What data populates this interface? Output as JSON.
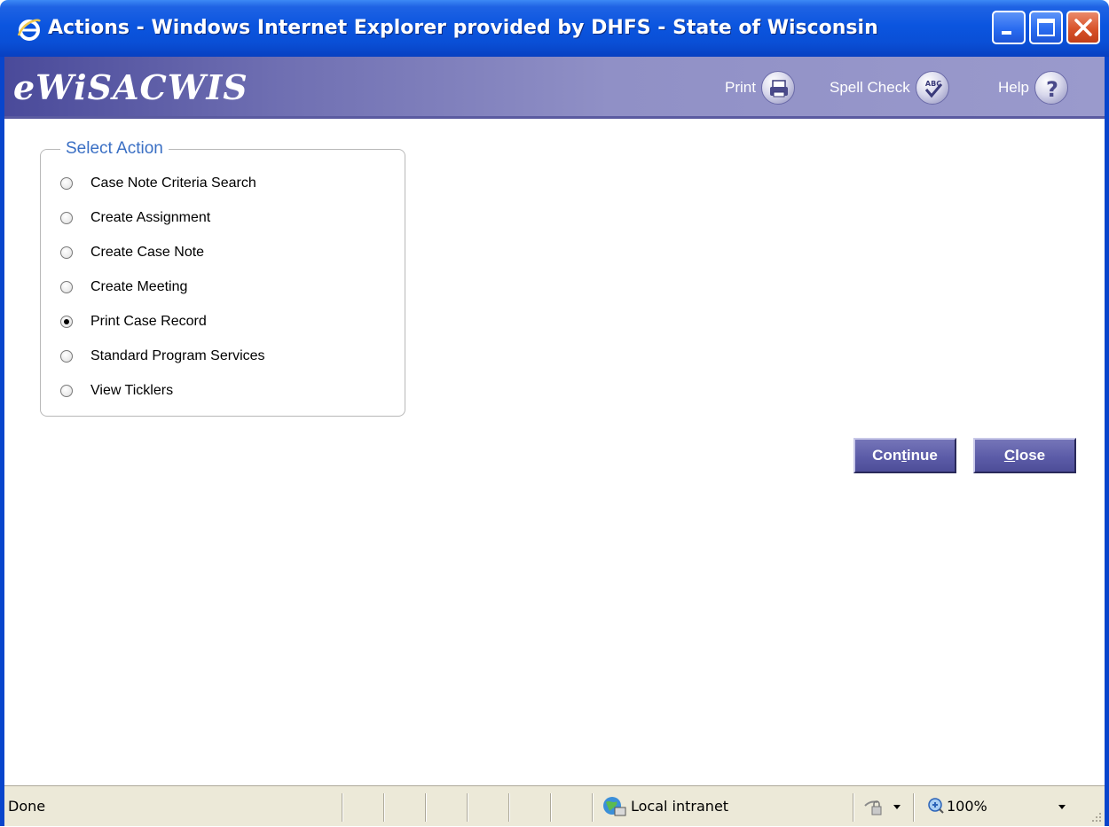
{
  "window": {
    "title": "Actions - Windows Internet Explorer provided by DHFS - State of Wisconsin"
  },
  "header": {
    "logo": "eWiSACWIS",
    "print_label": "Print",
    "spell_check_label": "Spell Check",
    "help_label": "Help"
  },
  "select_action": {
    "legend": "Select Action",
    "options": [
      {
        "label": "Case Note Criteria Search",
        "checked": false
      },
      {
        "label": "Create Assignment",
        "checked": false
      },
      {
        "label": "Create Case Note",
        "checked": false
      },
      {
        "label": "Create Meeting",
        "checked": false
      },
      {
        "label": "Print Case Record",
        "checked": true
      },
      {
        "label": "Standard Program Services",
        "checked": false
      },
      {
        "label": "View Ticklers",
        "checked": false
      }
    ]
  },
  "buttons": {
    "continue_pre": "Con",
    "continue_mnemonic": "t",
    "continue_post": "inue",
    "close_mnemonic": "C",
    "close_post": "lose"
  },
  "statusbar": {
    "status": "Done",
    "zone": "Local intranet",
    "zoom": "100%"
  },
  "colors": {
    "titlebar": "#0b55df",
    "header_gradient_start": "#4a4a9a",
    "header_gradient_end": "#9a9acc",
    "legend_text": "#3a6fc4",
    "button_bg": "#5c5ca8"
  },
  "icons": [
    "ie-logo-icon",
    "minimize-icon",
    "maximize-icon",
    "close-icon",
    "printer-icon",
    "spell-check-icon",
    "help-icon",
    "local-intranet-icon",
    "security-icon",
    "zoom-icon",
    "chevron-down-icon",
    "resize-grip-icon"
  ]
}
